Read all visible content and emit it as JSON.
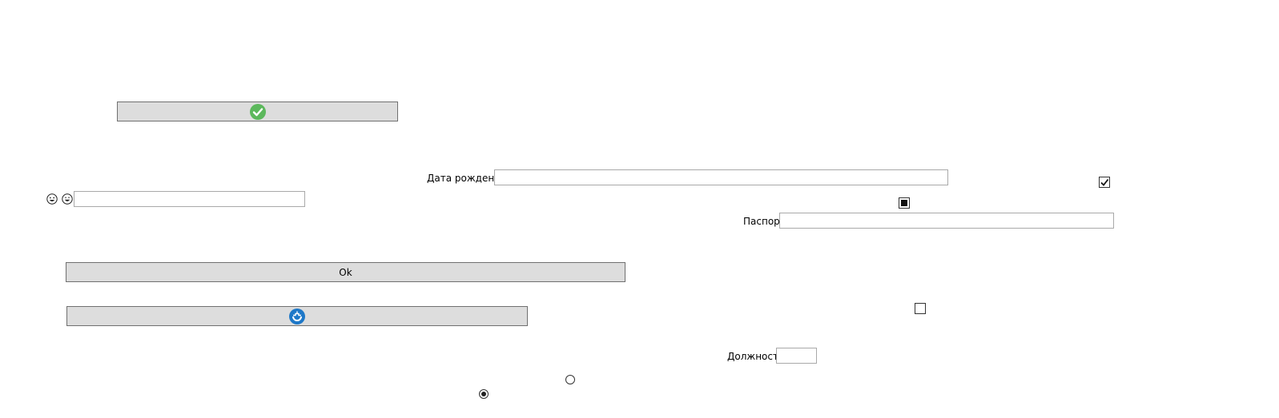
{
  "buttons": {
    "confirm_icon": "check-circle-icon",
    "ok_label": "Ok",
    "refresh_icon": "refresh-circle-icon"
  },
  "form": {
    "birth_date_label": "Дата рождения",
    "birth_date_value": "",
    "passport_label": "Паспорт",
    "passport_value": "",
    "position_label": "Должность",
    "position_value": "",
    "emoji_field_value": ""
  },
  "emoji_icons": [
    "smiley-face-icon",
    "grinning-face-icon"
  ],
  "checkboxes": {
    "top_right": "checked",
    "middle": "indeterminate",
    "lower": "unchecked"
  },
  "radios": {
    "upper": "unselected",
    "lower": "selected"
  },
  "colors": {
    "button_bg": "#dddddd",
    "button_border": "#707070",
    "check_green": "#5cb85c",
    "refresh_blue": "#1e78c8",
    "textbox_border": "#a9a9a9"
  }
}
